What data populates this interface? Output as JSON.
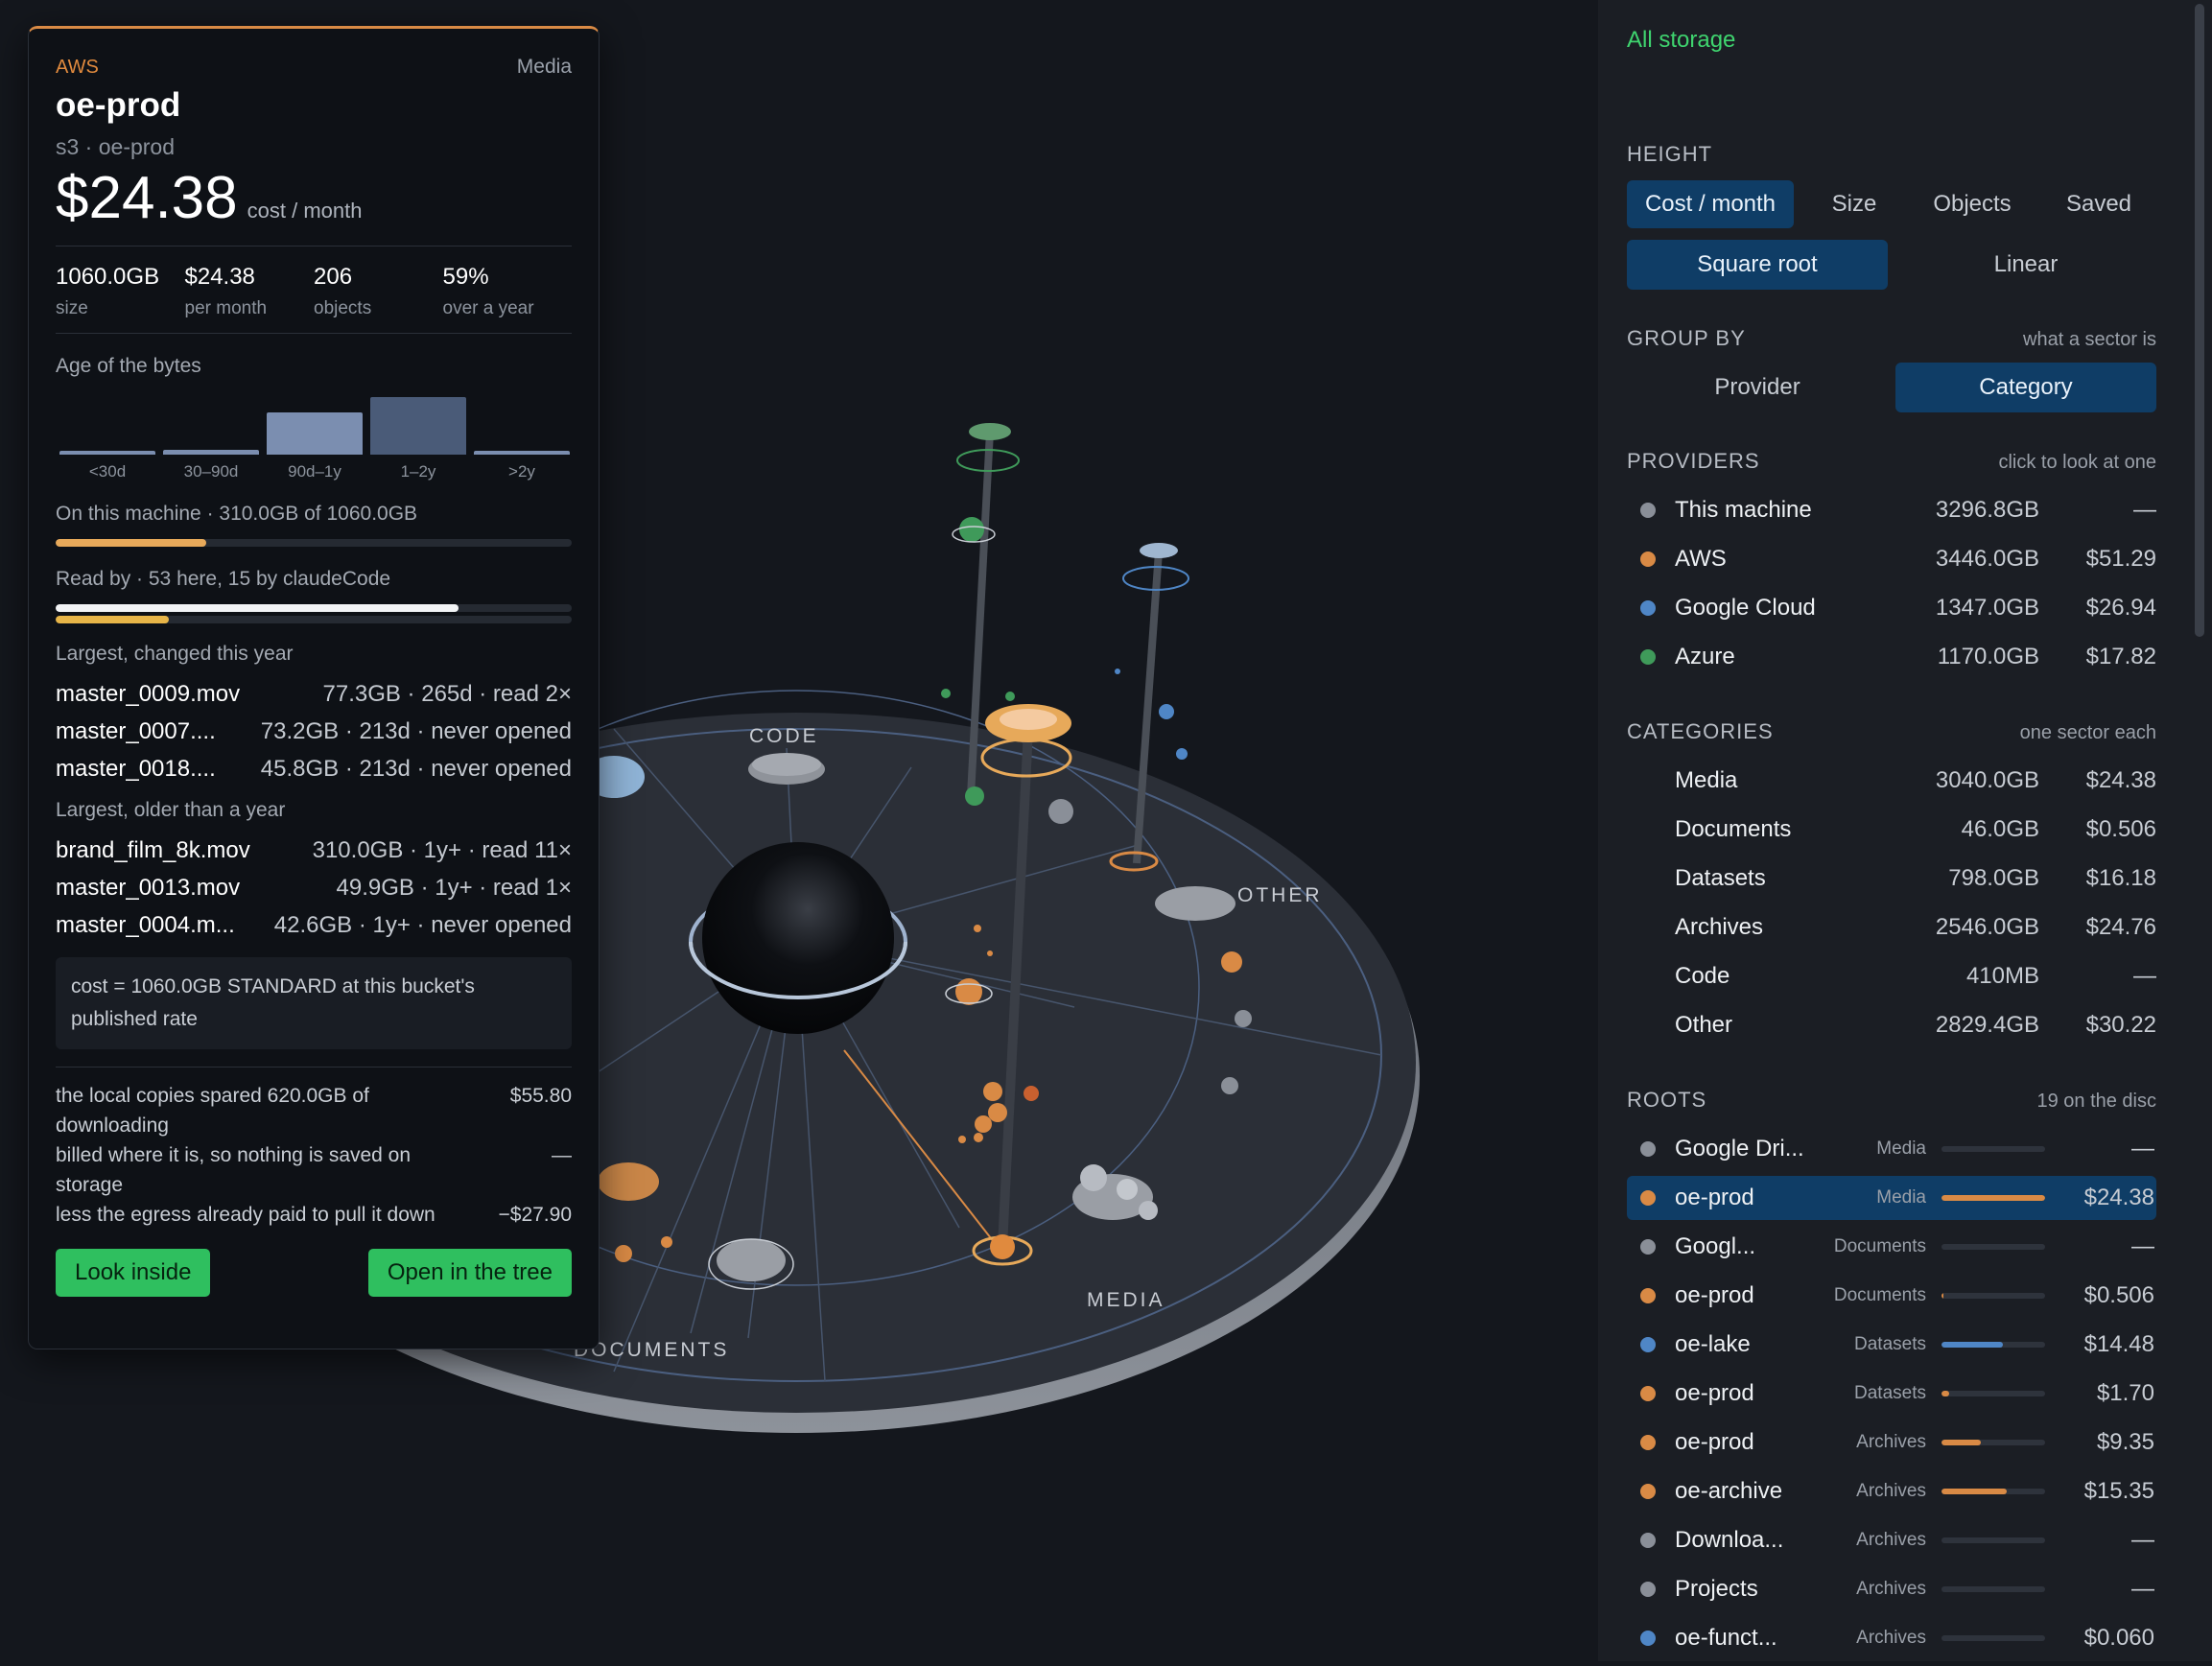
{
  "scene": {
    "labels": {
      "code": "CODE",
      "other": "OTHER",
      "media": "MEDIA",
      "documents": "DOCUMENTS"
    }
  },
  "card": {
    "provider": "AWS",
    "category": "Media",
    "title": "oe-prod",
    "subtitle": "s3 · oe-prod",
    "cost": "$24.38",
    "cost_unit": "cost / month",
    "stats": [
      {
        "value": "1060.0GB",
        "label": "size"
      },
      {
        "value": "$24.38",
        "label": "per month"
      },
      {
        "value": "206",
        "label": "objects"
      },
      {
        "value": "59%",
        "label": "over a year"
      }
    ],
    "age_title": "Age of the bytes",
    "age_hist": [
      {
        "label": "<30d",
        "share": 0.07
      },
      {
        "label": "30–90d",
        "share": 0.09
      },
      {
        "label": "90d–1y",
        "share": 0.74
      },
      {
        "label": "1–2y",
        "share": 1.0
      },
      {
        "label": ">2y",
        "share": 0.07
      }
    ],
    "machine_text": "On this machine · 310.0GB of 1060.0GB",
    "machine_fraction": 0.2925,
    "read_text": "Read by · 53 here, 15 by claudeCode",
    "read_here_fraction": 0.78,
    "read_claude_fraction": 0.22,
    "changed_title": "Largest, changed this year",
    "changed_files": [
      {
        "name": "master_0009.mov",
        "meta": "77.3GB · 265d · read 2×"
      },
      {
        "name": "master_0007....",
        "meta": "73.2GB · 213d · never opened"
      },
      {
        "name": "master_0018....",
        "meta": "45.8GB · 213d · never opened"
      }
    ],
    "older_title": "Largest, older than a year",
    "older_files": [
      {
        "name": "brand_film_8k.mov",
        "meta": "310.0GB · 1y+ · read 11×"
      },
      {
        "name": "master_0013.mov",
        "meta": "49.9GB · 1y+ · read 1×"
      },
      {
        "name": "master_0004.m...",
        "meta": "42.6GB · 1y+ · never opened"
      }
    ],
    "cost_note": "cost = 1060.0GB STANDARD at this bucket's published rate",
    "savings": [
      {
        "text": "the local copies spared 620.0GB of downloading",
        "amount": "$55.80"
      },
      {
        "text": "billed where it is, so nothing is saved on storage",
        "amount": "—"
      },
      {
        "text": "less the egress already paid to pull it down",
        "amount": "−$27.90"
      }
    ],
    "look_inside": "Look inside",
    "open_tree": "Open in the tree"
  },
  "panel": {
    "all_storage": "All storage",
    "height_title": "HEIGHT",
    "height_opts": [
      "Cost / month",
      "Size",
      "Objects",
      "Saved"
    ],
    "scale_opts": [
      "Square root",
      "Linear"
    ],
    "group_title": "GROUP BY",
    "group_hint": "what a sector is",
    "group_opts": [
      "Provider",
      "Category"
    ],
    "providers_title": "PROVIDERS",
    "providers_hint": "click to look at one",
    "providers": [
      {
        "name": "This machine",
        "size": "3296.8GB",
        "cost": "—",
        "color": "#8a8f98"
      },
      {
        "name": "AWS",
        "size": "3446.0GB",
        "cost": "$51.29",
        "color": "#d98a45"
      },
      {
        "name": "Google Cloud",
        "size": "1347.0GB",
        "cost": "$26.94",
        "color": "#4f86c6"
      },
      {
        "name": "Azure",
        "size": "1170.0GB",
        "cost": "$17.82",
        "color": "#3f9a5a"
      }
    ],
    "categories_title": "CATEGORIES",
    "categories_hint": "one sector each",
    "categories": [
      {
        "name": "Media",
        "size": "3040.0GB",
        "cost": "$24.38"
      },
      {
        "name": "Documents",
        "size": "46.0GB",
        "cost": "$0.506"
      },
      {
        "name": "Datasets",
        "size": "798.0GB",
        "cost": "$16.18"
      },
      {
        "name": "Archives",
        "size": "2546.0GB",
        "cost": "$24.76"
      },
      {
        "name": "Code",
        "size": "410MB",
        "cost": "—"
      },
      {
        "name": "Other",
        "size": "2829.4GB",
        "cost": "$30.22"
      }
    ],
    "roots_title": "ROOTS",
    "roots_hint": "19 on the disc",
    "roots": [
      {
        "name": "Google Dri...",
        "cat": "Media",
        "cost": "—",
        "color": "#8a8f98",
        "share": 0
      },
      {
        "name": "oe-prod",
        "cat": "Media",
        "cost": "$24.38",
        "color": "#d98a45",
        "share": 1.0
      },
      {
        "name": "Googl...",
        "cat": "Documents",
        "cost": "—",
        "color": "#8a8f98",
        "share": 0
      },
      {
        "name": "oe-prod",
        "cat": "Documents",
        "cost": "$0.506",
        "color": "#d98a45",
        "share": 0.02
      },
      {
        "name": "oe-lake",
        "cat": "Datasets",
        "cost": "$14.48",
        "color": "#4f86c6",
        "share": 0.59
      },
      {
        "name": "oe-prod",
        "cat": "Datasets",
        "cost": "$1.70",
        "color": "#d98a45",
        "share": 0.07
      },
      {
        "name": "oe-prod",
        "cat": "Archives",
        "cost": "$9.35",
        "color": "#d98a45",
        "share": 0.38
      },
      {
        "name": "oe-archive",
        "cat": "Archives",
        "cost": "$15.35",
        "color": "#d98a45",
        "share": 0.63
      },
      {
        "name": "Downloa...",
        "cat": "Archives",
        "cost": "—",
        "color": "#8a8f98",
        "share": 0
      },
      {
        "name": "Projects",
        "cat": "Archives",
        "cost": "—",
        "color": "#8a8f98",
        "share": 0
      },
      {
        "name": "oe-funct...",
        "cat": "Archives",
        "cost": "$0.060",
        "color": "#4f86c6",
        "share": 0
      }
    ]
  }
}
